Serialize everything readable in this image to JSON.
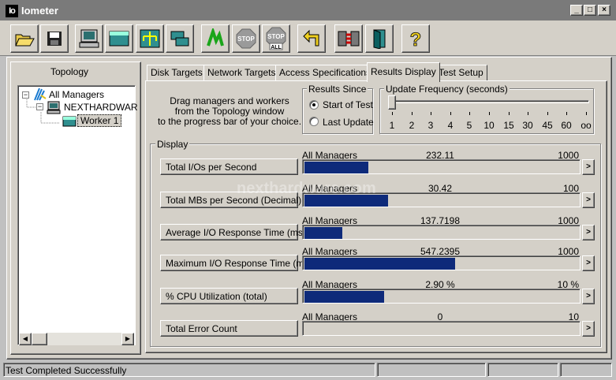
{
  "window": {
    "logo_text": "Io",
    "title": "Iometer",
    "minimize_glyph": "_",
    "maximize_glyph": "□",
    "close_glyph": "×"
  },
  "toolbar": {
    "buttons": [
      {
        "icon": "open-folder-icon"
      },
      {
        "icon": "save-disk-icon"
      },
      {
        "icon": "display-manager-icon"
      },
      {
        "icon": "new-disk-worker-icon"
      },
      {
        "icon": "new-network-worker-icon"
      },
      {
        "icon": "duplicate-worker-icon"
      },
      {
        "icon": "start-tests-icon"
      },
      {
        "icon": "stop-icon"
      },
      {
        "icon": "stop-all-icon"
      },
      {
        "icon": "reset-workers-icon"
      },
      {
        "icon": "disconnect-manager-icon"
      },
      {
        "icon": "exit-icon"
      },
      {
        "icon": "about-icon"
      }
    ],
    "stop_label": "STOP",
    "stop_all_label_top": "STOP",
    "stop_all_label_bottom": "ALL",
    "help_glyph": "?"
  },
  "topology": {
    "title": "Topology",
    "root": "All Managers",
    "manager": "NEXTHARDWAR",
    "worker": "Worker 1",
    "expander_glyph": "−"
  },
  "tabs": [
    {
      "label": "Disk Targets"
    },
    {
      "label": "Network Targets"
    },
    {
      "label": "Access Specifications"
    },
    {
      "label": "Results Display",
      "active": true
    },
    {
      "label": "Test Setup"
    }
  ],
  "results_display": {
    "drag_hint": [
      "Drag managers and workers",
      "from the Topology window",
      "to the progress bar of your choice."
    ],
    "results_since": {
      "title": "Results Since",
      "options": [
        "Start of Test",
        "Last Update"
      ],
      "selected": "Start of Test"
    },
    "update_frequency": {
      "title": "Update Frequency (seconds)",
      "ticks": [
        "1",
        "2",
        "3",
        "4",
        "5",
        "10",
        "15",
        "30",
        "45",
        "60",
        "oo"
      ],
      "selected_index": 0
    },
    "display_title": "Display",
    "metrics": [
      {
        "name": "Total I/Os per Second",
        "scope": "All Managers",
        "value": "232.11",
        "max": "1000",
        "fill_fraction": 0.232
      },
      {
        "name": "Total MBs per Second (Decimal)",
        "scope": "All Managers",
        "value": "30.42",
        "max": "100",
        "fill_fraction": 0.304
      },
      {
        "name": "Average I/O Response Time (ms)",
        "scope": "All Managers",
        "value": "137.7198",
        "max": "1000",
        "fill_fraction": 0.138
      },
      {
        "name": "Maximum I/O Response Time (ms)",
        "scope": "All Managers",
        "value": "547.2395",
        "max": "1000",
        "fill_fraction": 0.547
      },
      {
        "name": "% CPU Utilization (total)",
        "scope": "All Managers",
        "value": "2.90 %",
        "max": "10 %",
        "fill_fraction": 0.29
      },
      {
        "name": "Total Error Count",
        "scope": "All Managers",
        "value": "0",
        "max": "10",
        "fill_fraction": 0
      }
    ],
    "expand_glyph": ">"
  },
  "watermark": "nexthardware.com",
  "status_bar": {
    "text": "Test Completed Successfully"
  },
  "colors": {
    "bar": "#0e2a7a",
    "title_bar": "#7a7a7a",
    "face": "#d4d0c8"
  }
}
